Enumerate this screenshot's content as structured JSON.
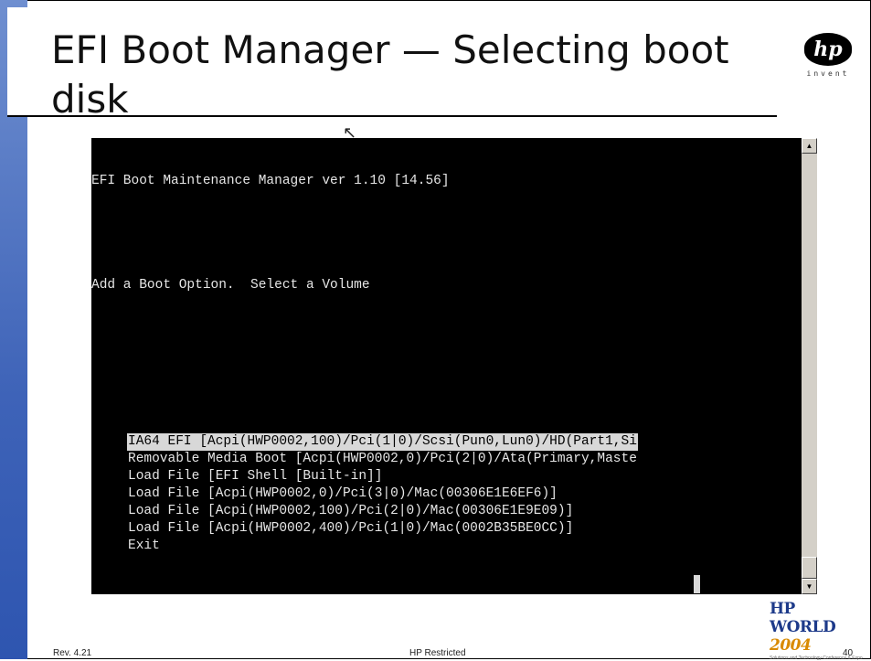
{
  "slide": {
    "title": "EFI Boot Manager — Selecting boot disk",
    "logo_tag": "invent",
    "logo_text": "hp"
  },
  "console": {
    "header": "EFI Boot Maintenance Manager ver 1.10 [14.56]",
    "prompt": "Add a Boot Option.  Select a Volume",
    "items": [
      {
        "label": "IA64 EFI [Acpi(HWP0002,100)/Pci(1|0)/Scsi(Pun0,Lun0)/HD(Part1,Si",
        "selected": true
      },
      {
        "label": "Removable Media Boot [Acpi(HWP0002,0)/Pci(2|0)/Ata(Primary,Maste",
        "selected": false
      },
      {
        "label": "Load File [EFI Shell [Built-in]]",
        "selected": false
      },
      {
        "label": "Load File [Acpi(HWP0002,0)/Pci(3|0)/Mac(00306E1E6EF6)]",
        "selected": false
      },
      {
        "label": "Load File [Acpi(HWP0002,100)/Pci(2|0)/Mac(00306E1E9E09)]",
        "selected": false
      },
      {
        "label": "Load File [Acpi(HWP0002,400)/Pci(1|0)/Mac(0002B35BE0CC)]",
        "selected": false
      },
      {
        "label": "Exit",
        "selected": false
      }
    ]
  },
  "scrollbar": {
    "up_icon": "▲",
    "down_icon": "▼"
  },
  "branding": {
    "hpworld": "HP WORLD",
    "year": "2004",
    "tagline": "Solutions and Technology Conference & Expo"
  },
  "footer": {
    "revision": "Rev. 4.21",
    "classification": "HP Restricted",
    "page_number": "40"
  }
}
